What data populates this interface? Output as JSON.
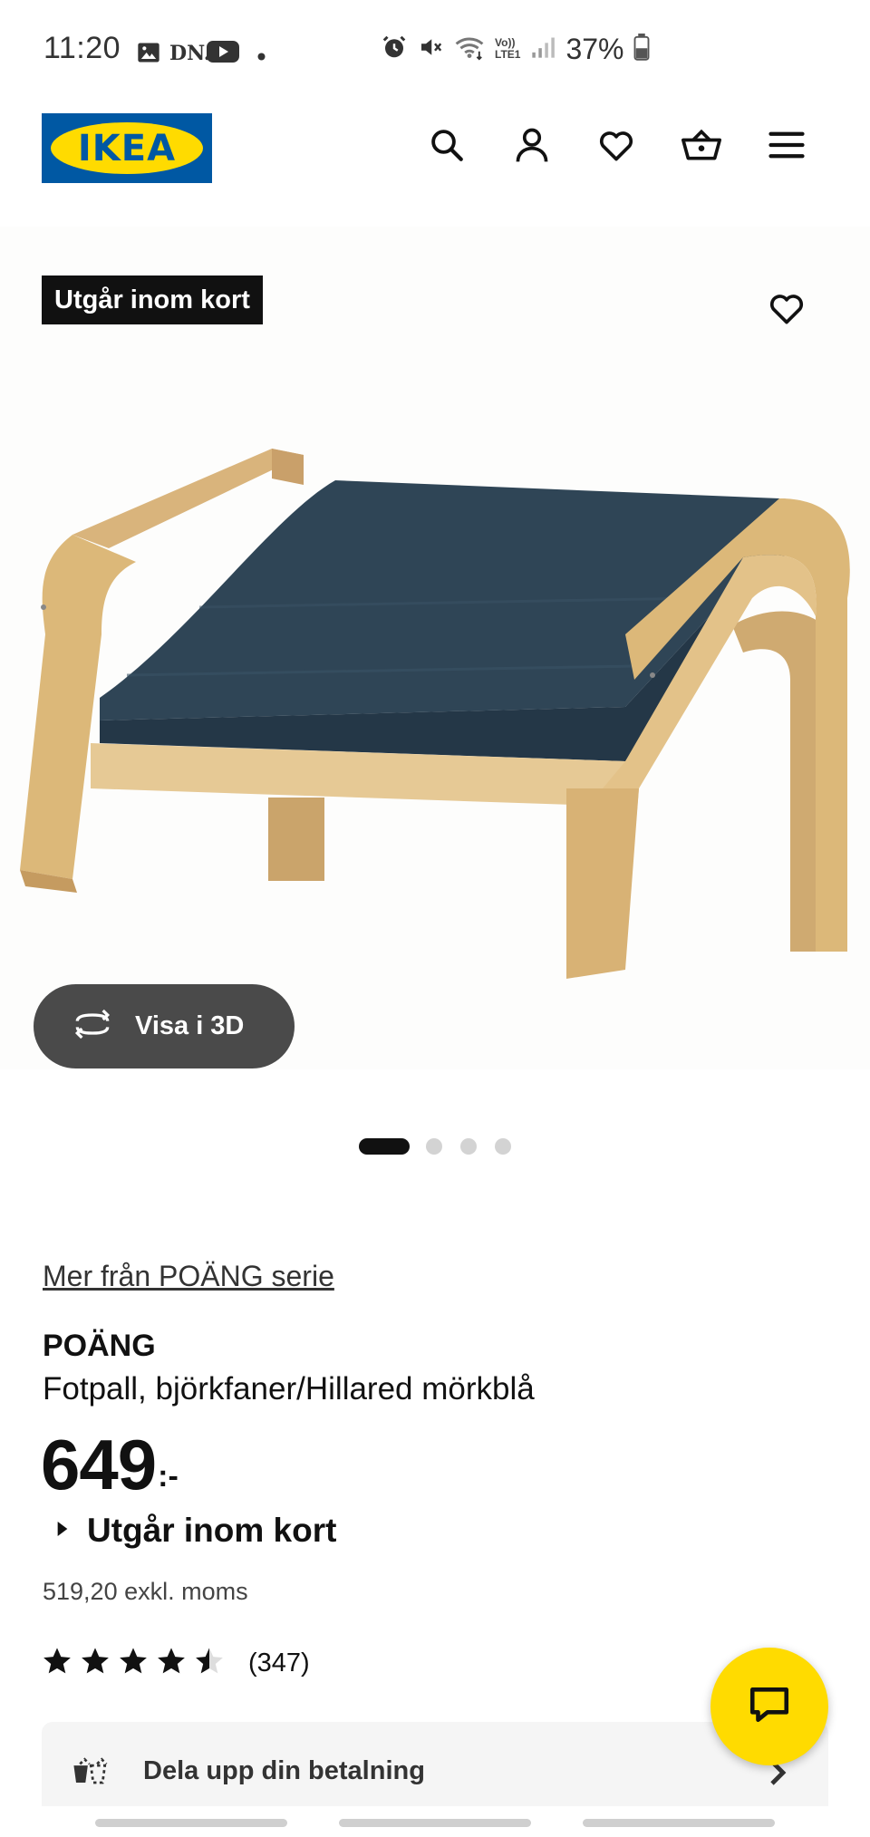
{
  "status_bar": {
    "time": "11:20",
    "left_icons": [
      "image-icon",
      "dn-app-icon",
      "youtube-icon",
      "dot-icon"
    ],
    "dn_label": "DN.",
    "right_icons": [
      "alarm-icon",
      "mute-icon",
      "wifi-icon",
      "volte-icon",
      "signal-icon",
      "battery-icon"
    ],
    "volte_label_top": "Vo))",
    "volte_label_bottom": "LTE1",
    "battery": "37%"
  },
  "header": {
    "logo_text": "IKEA",
    "brand_colors": {
      "blue": "#0058A3",
      "yellow": "#FFDB00"
    },
    "icons": [
      "search-icon",
      "account-icon",
      "heart-icon",
      "cart-icon",
      "menu-icon"
    ]
  },
  "product_image": {
    "badge": "Utgår inom kort",
    "view_3d_label": "Visa i 3D",
    "carousel": {
      "total": 4,
      "active": 1
    }
  },
  "product": {
    "series_link": "Mer från POÄNG serie",
    "name": "POÄNG",
    "description": "Fotpall, björkfaner/Hillared mörkblå",
    "price_integer": "649",
    "price_suffix": ":-",
    "availability": "Utgår inom kort",
    "price_excl_vat": "519,20 exkl. moms",
    "rating": 4.5,
    "rating_count": "(347)"
  },
  "payment_banner": {
    "label": "Dela upp din betalning"
  },
  "chat": {
    "icon": "chat-icon",
    "color": "#FFDB00"
  }
}
